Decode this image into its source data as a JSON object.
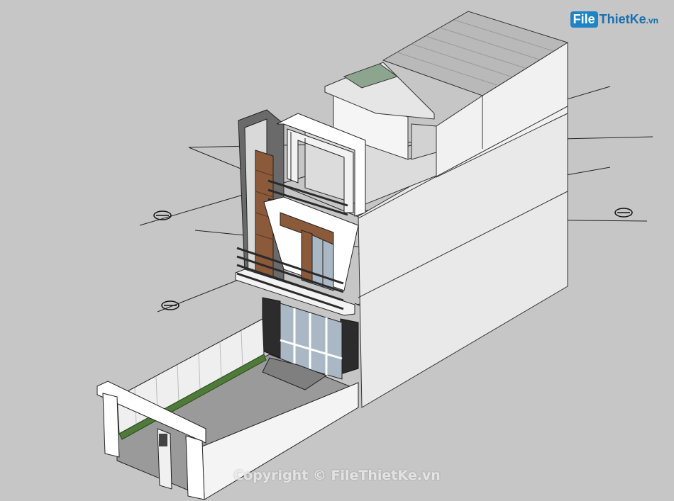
{
  "watermark": {
    "logo_box": "File",
    "logo_rest": "ThietKe",
    "logo_ext": ".vn",
    "copyright": "Copyright © FileThietKe.vn"
  },
  "colors": {
    "background": "#c6c6c6",
    "wall": "#ffffff",
    "wall_shade": "#e6e6e6",
    "wood": "#8a5a3a",
    "glass": "#a9b8c4",
    "railing": "#2a2a2a",
    "grass": "#4f7a3a",
    "roof": "#b5b5b5",
    "logo_blue": "#1e84c8"
  }
}
